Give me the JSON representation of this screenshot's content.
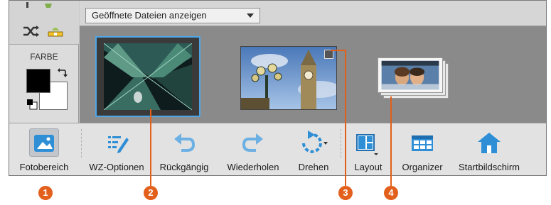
{
  "tool_panel": {
    "color_label": "FARBE",
    "icons": [
      "shuffle-icon",
      "level-icon"
    ]
  },
  "photo_bin": {
    "dropdown_value": "Geöffnete Dateien anzeigen",
    "thumbnails": [
      {
        "name": "architecture-photo",
        "selected": true
      },
      {
        "name": "big-ben-photo",
        "selected": false,
        "badge": true
      },
      {
        "name": "stacked-collage-photo",
        "selected": false,
        "stacked": true
      }
    ]
  },
  "toolbar": {
    "photo_bin_label": "Fotobereich",
    "tool_options_label": "WZ-Optionen",
    "undo_label": "Rückgängig",
    "redo_label": "Wiederholen",
    "rotate_label": "Drehen",
    "layout_label": "Layout",
    "organizer_label": "Organizer",
    "home_label": "Startbildschirm"
  },
  "callouts": [
    "1",
    "2",
    "3",
    "4"
  ],
  "colors": {
    "accent": "#e2601b",
    "selection": "#4ea6e8",
    "icon_blue": "#2e8fd6"
  }
}
